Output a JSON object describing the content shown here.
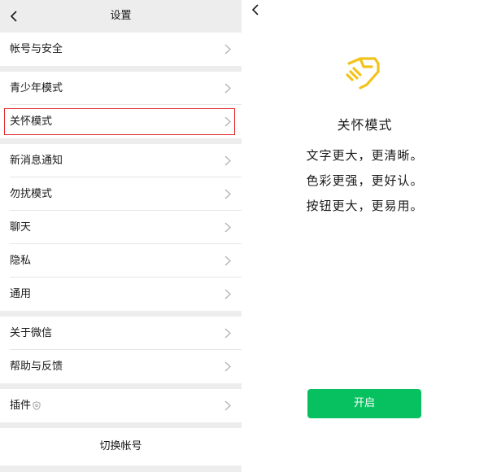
{
  "settings": {
    "title": "设置",
    "items": [
      {
        "label": "帐号与安全"
      },
      {
        "label": "青少年模式"
      },
      {
        "label": "关怀模式"
      },
      {
        "label": "新消息通知"
      },
      {
        "label": "勿扰模式"
      },
      {
        "label": "聊天"
      },
      {
        "label": "隐私"
      },
      {
        "label": "通用"
      },
      {
        "label": "关于微信"
      },
      {
        "label": "帮助与反馈"
      },
      {
        "label": "插件"
      }
    ],
    "switch_account": "切换帐号",
    "highlight_color": "#e0252b"
  },
  "care_mode": {
    "title": "关怀模式",
    "lines": [
      "文字更大，更清晰。",
      "色彩更强，更好认。",
      "按钮更大，更易用。"
    ],
    "open_button": "开启",
    "accent": "#07c160",
    "icon_color": "#f2c31a"
  }
}
